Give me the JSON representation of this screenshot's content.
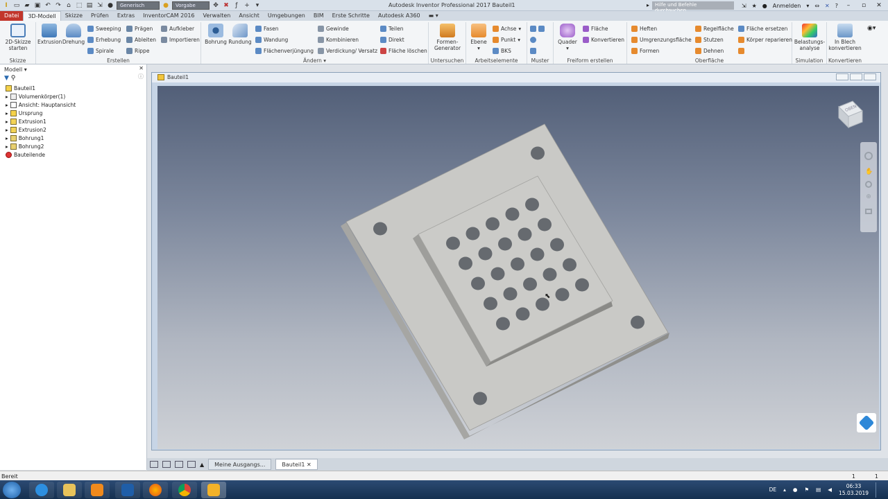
{
  "window": {
    "title": "Autodesk Inventor Professional 2017    Bauteil1",
    "search_placeholder": "Hilfe und Befehle durchsuchen...",
    "signin_label": "Anmelden",
    "material_combo": "Generisch",
    "appearance_combo": "Vorgabe"
  },
  "tabs": [
    {
      "label": "Datei"
    },
    {
      "label": "3D-Modell"
    },
    {
      "label": "Skizze"
    },
    {
      "label": "Prüfen"
    },
    {
      "label": "Extras"
    },
    {
      "label": "InventorCAM 2016"
    },
    {
      "label": "Verwalten"
    },
    {
      "label": "Ansicht"
    },
    {
      "label": "Umgebungen"
    },
    {
      "label": "BIM"
    },
    {
      "label": "Erste Schritte"
    },
    {
      "label": "Autodesk A360"
    }
  ],
  "ribbon": {
    "skizze": {
      "label": "Skizze",
      "start": "2D-Skizze starten"
    },
    "erstellen": {
      "label": "Erstellen",
      "extrusion": "Extrusion",
      "drehung": "Drehung",
      "sweeping": "Sweeping",
      "erhebung": "Erhebung",
      "spirale": "Spirale",
      "praegen": "Prägen",
      "ableiten": "Ableiten",
      "rippe": "Rippe",
      "aufkleber": "Aufkleber",
      "importieren": "Importieren"
    },
    "aendern": {
      "label": "Ändern",
      "bohrung": "Bohrung",
      "rundung": "Rundung",
      "fasen": "Fasen",
      "wandung": "Wandung",
      "flaechenverj": "Flächenverjüngung",
      "gewinde": "Gewinde",
      "kombinieren": "Kombinieren",
      "verdickung": "Verdickung/ Versatz",
      "teilen": "Teilen",
      "direkt": "Direkt",
      "flaeche_loeschen": "Fläche löschen"
    },
    "untersuchen": {
      "label": "Untersuchen",
      "formen_generator": "Formen-Generator"
    },
    "arbeitselemente": {
      "label": "Arbeitselemente",
      "ebene": "Ebene",
      "achse": "Achse",
      "punkt": "Punkt",
      "bks": "BKS"
    },
    "muster": {
      "label": "Muster"
    },
    "freiform": {
      "label": "Freiform erstellen",
      "quader": "Quader",
      "flaeche": "Fläche",
      "konvertieren": "Konvertieren"
    },
    "oberflaeche": {
      "label": "Oberfläche",
      "heften": "Heften",
      "umgrenzungsflaeche": "Umgrenzungsfläche",
      "formen": "Formen",
      "regelflaeche": "Regelfläche",
      "stutzen": "Stutzen",
      "dehnen": "Dehnen",
      "flaeche_ersetzen": "Fläche ersetzen",
      "koerper_reparieren": "Körper reparieren"
    },
    "simulation": {
      "label": "Simulation",
      "belastung": "Belastungs-analyse"
    },
    "konvertieren": {
      "label": "Konvertieren",
      "blech": "In Blech konvertieren"
    }
  },
  "browser": {
    "header": "Modell",
    "items": [
      {
        "label": "Bauteil1"
      },
      {
        "label": "Volumenkörper(1)"
      },
      {
        "label": "Ansicht: Hauptansicht"
      },
      {
        "label": "Ursprung"
      },
      {
        "label": "Extrusion1"
      },
      {
        "label": "Extrusion2"
      },
      {
        "label": "Bohrung1"
      },
      {
        "label": "Bohrung2"
      },
      {
        "label": "Bauteilende"
      }
    ]
  },
  "graphics": {
    "doc_title": "Bauteil1",
    "viewcube_face": "OBEN"
  },
  "doctabs": [
    {
      "label": "Meine Ausgangs..."
    },
    {
      "label": "Bauteil1"
    }
  ],
  "status": {
    "text": "Bereit",
    "num1": "1",
    "num2": "1"
  },
  "taskbar": {
    "lang": "DE",
    "time": "06:33",
    "date": "15.03.2019"
  },
  "colors": {
    "file_tab": "#c2362b",
    "plate": "#c9c9c6",
    "hole": "#666a6f"
  }
}
